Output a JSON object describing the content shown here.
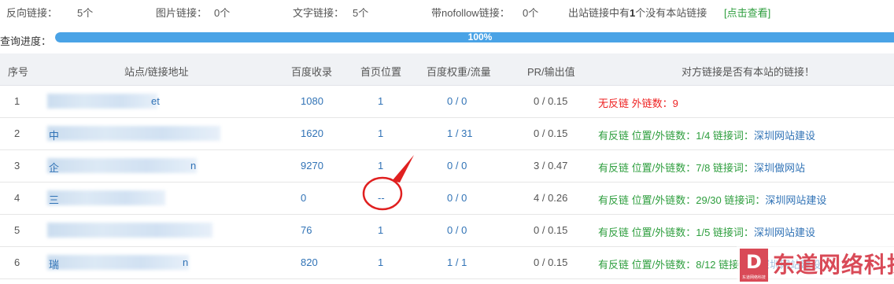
{
  "summary": {
    "backlinks_label": "反向链接：",
    "backlinks_value": "5个",
    "image_links_label": "图片链接：",
    "image_links_value": "0个",
    "text_links_label": "文字链接：",
    "text_links_value": "5个",
    "nofollow_label": "带nofollow链接：",
    "nofollow_value": "0个",
    "outbound_note_pre": "出站链接中有",
    "outbound_note_count": "1",
    "outbound_note_post": "个没有本站链接",
    "view_link": "[点击查看]"
  },
  "progress": {
    "label": "查询进度：",
    "value_text": "100%",
    "percent": 100
  },
  "table": {
    "headers": {
      "index": "序号",
      "site": "站点/链接地址",
      "baidu_index": "百度收录",
      "home_position": "首页位置",
      "baidu_weight": "百度权重/流量",
      "pr": "PR/输出值",
      "backlink_check": "对方链接是否有本站的链接！"
    },
    "rows": [
      {
        "index": "1",
        "site_prefix": "",
        "site_suffix": "et",
        "baidu_index": "1080",
        "home_position": "1",
        "baidu_weight": "0 / 0",
        "pr": "0 / 0.15",
        "status": "无反链",
        "detail": " 外链数：9",
        "status_color": "red"
      },
      {
        "index": "2",
        "site_prefix": "中",
        "site_suffix": "",
        "baidu_index": "1620",
        "home_position": "1",
        "baidu_weight": "1 / 31",
        "pr": "0 / 0.15",
        "status": "有反链",
        "detail": "  位置/外链数：1/4  链接词：",
        "anchor": "深圳网站建设",
        "status_color": "green"
      },
      {
        "index": "3",
        "site_prefix": "企",
        "site_suffix": "n",
        "baidu_index": "9270",
        "home_position": "1",
        "baidu_weight": "0 / 0",
        "pr": "3 / 0.47",
        "status": "有反链",
        "detail": "  位置/外链数：7/8  链接词：",
        "anchor": "深圳做网站",
        "status_color": "green"
      },
      {
        "index": "4",
        "site_prefix": "三",
        "site_suffix": "",
        "baidu_index": "0",
        "home_position": "--",
        "baidu_weight": "0 / 0",
        "pr": "4 / 0.26",
        "status": "有反链",
        "detail": "  位置/外链数：29/30  链接词：",
        "anchor": "深圳网站建设",
        "status_color": "green"
      },
      {
        "index": "5",
        "site_prefix": "",
        "site_suffix": "",
        "baidu_index": "76",
        "home_position": "1",
        "baidu_weight": "0 / 0",
        "pr": "0 / 0.15",
        "status": "有反链",
        "detail": "  位置/外链数：1/5  链接词：",
        "anchor": "深圳网站建设",
        "status_color": "green"
      },
      {
        "index": "6",
        "site_prefix": "瑞",
        "site_suffix": "n",
        "baidu_index": "820",
        "home_position": "1",
        "baidu_weight": "1 / 1",
        "pr": "0 / 0.15",
        "status": "有反链",
        "detail": "  位置/外链数：8/12  链接词：",
        "anchor": "深圳网站建设",
        "status_color": "green"
      }
    ]
  },
  "watermark": {
    "logo_letter": "D",
    "small_text": "东道网络科技",
    "brand": "东道网络科技"
  },
  "colors": {
    "accent_blue": "#4aa3e6",
    "link_blue": "#3173b6",
    "green": "#2e9e3e",
    "red": "#e22222",
    "annotation_red": "#e02020"
  }
}
